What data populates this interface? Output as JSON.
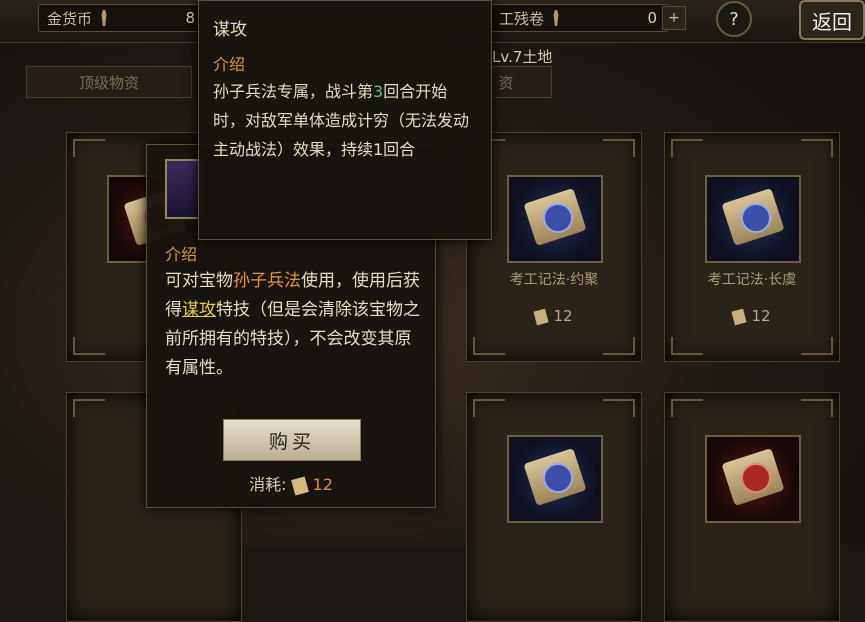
{
  "topbar": {
    "gold_label": "金货币",
    "gold_value": "8",
    "scroll_label": "工残卷",
    "scroll_value": "0",
    "help": "?",
    "back": "返回"
  },
  "tabs": {
    "tab1": "顶级物资",
    "tab2": "资"
  },
  "land_label": "Lv.7土地",
  "cards": [
    {
      "name": "考工记法·约聚",
      "cost": "12",
      "theme": "blue"
    },
    {
      "name": "考工记法·长虞",
      "cost": "12",
      "theme": "blue"
    },
    {
      "name": "",
      "cost": "",
      "theme": "blue"
    },
    {
      "name": "",
      "cost": "",
      "theme": "red"
    }
  ],
  "skill_tip": {
    "title": "谋攻",
    "section": "介绍",
    "desc_a": "孙子兵法专属，战斗第",
    "desc_num": "3",
    "desc_b": "回合开始时，对敌军单体造成计穷（无法发动主动战法）效果，持续1回合"
  },
  "item_tip": {
    "section": "介绍",
    "d1": "可对宝物",
    "d2": "孙子兵法",
    "d3": "使用，使用后获得",
    "d4": "谋攻",
    "d5": "特技（但是会清除该宝物之前所拥有的特技），不会改变其原有属性。",
    "buy": "购买",
    "consume_label": "消耗:",
    "consume_value": "12"
  }
}
